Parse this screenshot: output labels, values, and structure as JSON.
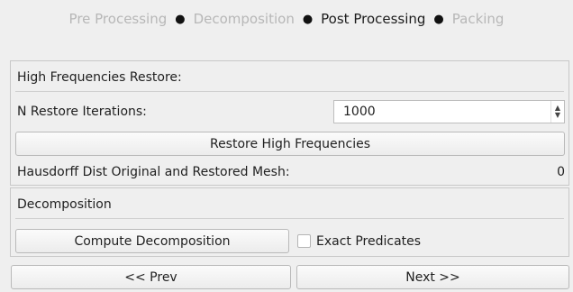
{
  "wizard_steps": [
    {
      "label": "Pre Processing",
      "active": false
    },
    {
      "label": "Decomposition",
      "active": false
    },
    {
      "label": "Post Processing",
      "active": true
    },
    {
      "label": "Packing",
      "active": false
    }
  ],
  "high_freq": {
    "title": "High Frequencies Restore:",
    "n_restore_label": "N Restore Iterations:",
    "n_restore_value": "1000",
    "restore_button": "Restore High Frequencies",
    "hausdorff_label": "Hausdorff Dist Original and Restored Mesh:",
    "hausdorff_value": "0"
  },
  "decomposition": {
    "title": "Decomposition",
    "compute_button": "Compute Decomposition",
    "exact_predicates_label": "Exact Predicates",
    "exact_predicates_checked": false
  },
  "nav": {
    "prev": "<< Prev",
    "next": "Next >>"
  }
}
